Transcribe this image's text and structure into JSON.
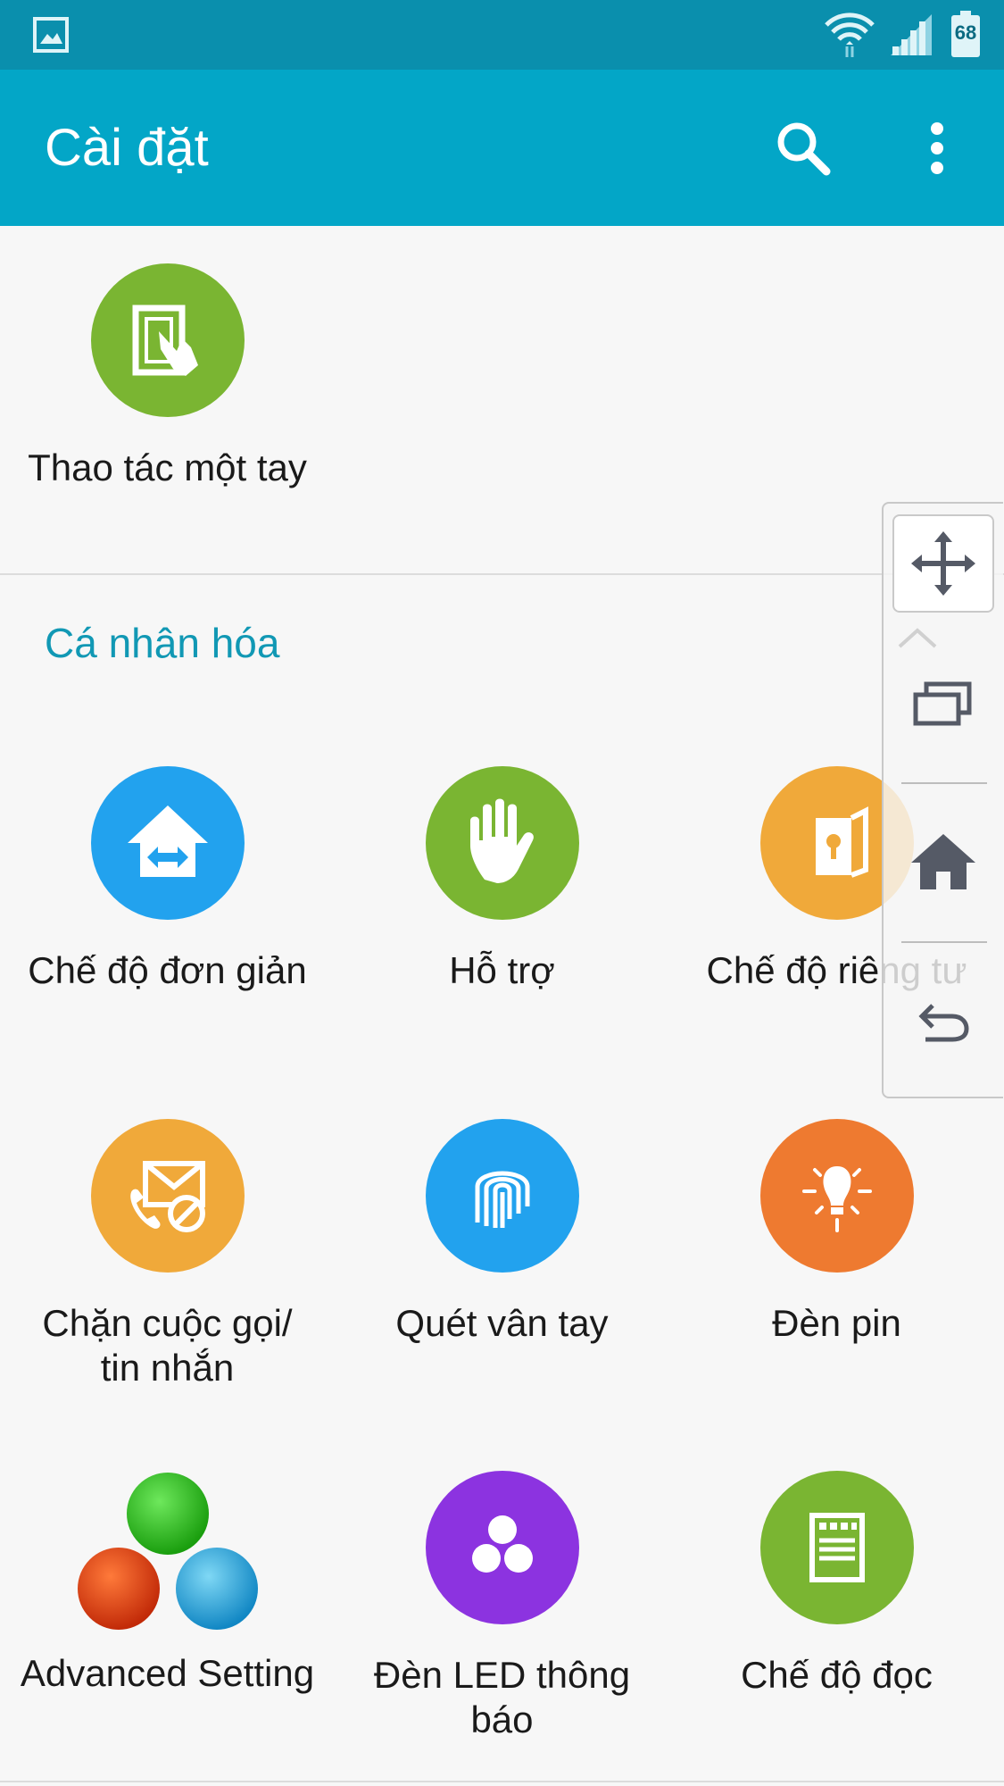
{
  "status_bar": {
    "battery_level": "68",
    "icons": [
      "picture-icon",
      "wifi-icon",
      "signal-icon",
      "battery-icon"
    ]
  },
  "app_bar": {
    "title": "Cài đặt",
    "icons": [
      "search-icon",
      "more-vert-icon"
    ]
  },
  "top_item": {
    "label": "Thao tác một tay",
    "icon": "one-hand-icon",
    "color": "#7ab532"
  },
  "section": {
    "title": "Cá nhân hóa",
    "items": [
      {
        "label": "Chế độ đơn giản",
        "icon": "easy-mode-icon",
        "color": "#22a2ee"
      },
      {
        "label": "Hỗ trợ",
        "icon": "hand-icon",
        "color": "#7ab532"
      },
      {
        "label": "Chế độ riêng tư",
        "icon": "private-mode-icon",
        "color": "#f0a93a"
      },
      {
        "label": "Chặn cuộc gọi/ tin nhắn",
        "icon": "block-call-icon",
        "color": "#f0a93a"
      },
      {
        "label": "Quét vân tay",
        "icon": "fingerprint-icon",
        "color": "#22a2ee"
      },
      {
        "label": "Đèn pin",
        "icon": "flashlight-icon",
        "color": "#ee7a30"
      },
      {
        "label": "Advanced Setting",
        "icon": "three-balls-icon",
        "color": "#2bb51b"
      },
      {
        "label": "Đèn LED thông báo",
        "icon": "led-icon",
        "color": "#8c33e0"
      },
      {
        "label": "Chế độ đọc",
        "icon": "reading-mode-icon",
        "color": "#7ab532"
      }
    ]
  },
  "floating_panel": {
    "icons": [
      "move-icon",
      "chevron-up-icon",
      "recent-apps-icon",
      "home-icon",
      "back-icon"
    ]
  }
}
